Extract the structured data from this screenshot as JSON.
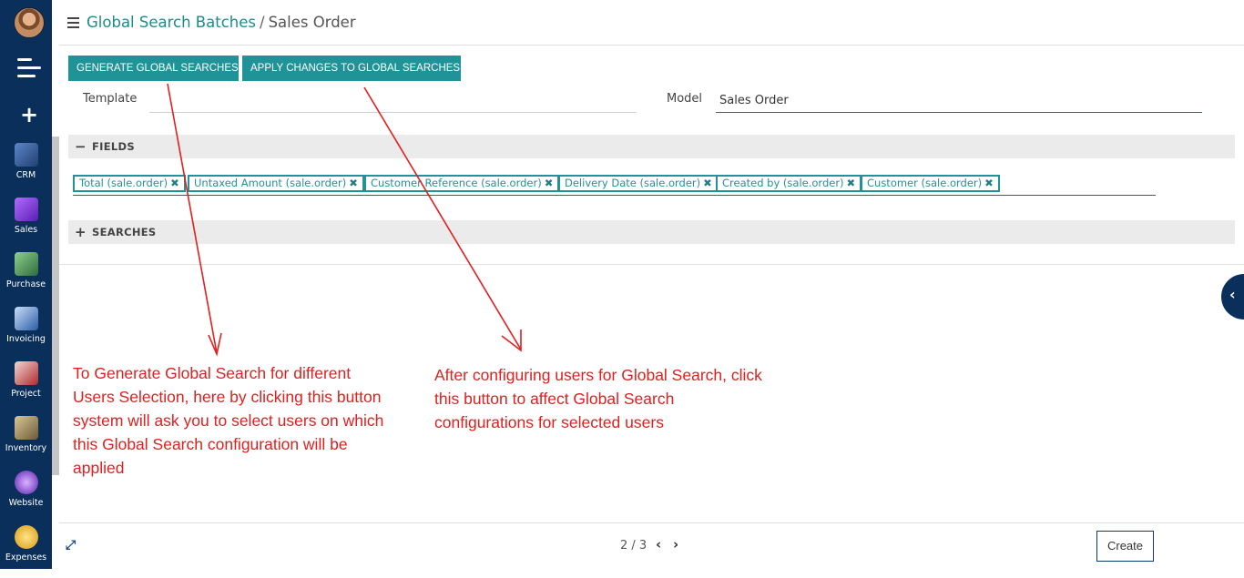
{
  "breadcrumb": {
    "parent": "Global Search Batches",
    "separator": "/",
    "current": "Sales Order"
  },
  "sidebar": {
    "apps": [
      {
        "label": "CRM",
        "icon": "crm-icon",
        "color": "#3b5f94"
      },
      {
        "label": "Sales",
        "icon": "sales-icon",
        "color": "#7b3fc8"
      },
      {
        "label": "Purchase",
        "icon": "purchase-icon",
        "color": "#4f8f54"
      },
      {
        "label": "Invoicing",
        "icon": "invoicing-icon",
        "color": "#3a6fc0"
      },
      {
        "label": "Project",
        "icon": "project-icon",
        "color": "#c23b3b"
      },
      {
        "label": "Inventory",
        "icon": "inventory-icon",
        "color": "#a08a5a"
      },
      {
        "label": "Website",
        "icon": "website-icon",
        "color": "#7a3ad6"
      },
      {
        "label": "Expenses",
        "icon": "expenses-icon",
        "color": "#e0a419"
      }
    ]
  },
  "toolbar": {
    "generate_label": "GENERATE GLOBAL SEARCHES",
    "apply_label": "APPLY CHANGES TO GLOBAL SEARCHES"
  },
  "form": {
    "template_label": "Template",
    "template_value": "",
    "model_label": "Model",
    "model_value": "Sales Order",
    "fields_section": "FIELDS",
    "searches_section": "SEARCHES",
    "fields_tags": [
      "Total (sale.order)",
      "Untaxed Amount (sale.order)",
      "Customer Reference (sale.order)",
      "Delivery Date (sale.order)",
      "Created by (sale.order)",
      "Customer (sale.order)"
    ]
  },
  "annotations": {
    "left": "To Generate Global Search for different Users Selection, here by clicking this button system will ask you to select users on which this Global Search configuration will be applied",
    "right": "After configuring users for Global Search, click this button to affect Global Search configurations for selected users",
    "color": "#e02020"
  },
  "pager": {
    "text": "2 / 3"
  },
  "footer": {
    "create_label": "Create"
  },
  "colors": {
    "sidebar": "#0b2f5b",
    "accent": "#1f9398"
  }
}
